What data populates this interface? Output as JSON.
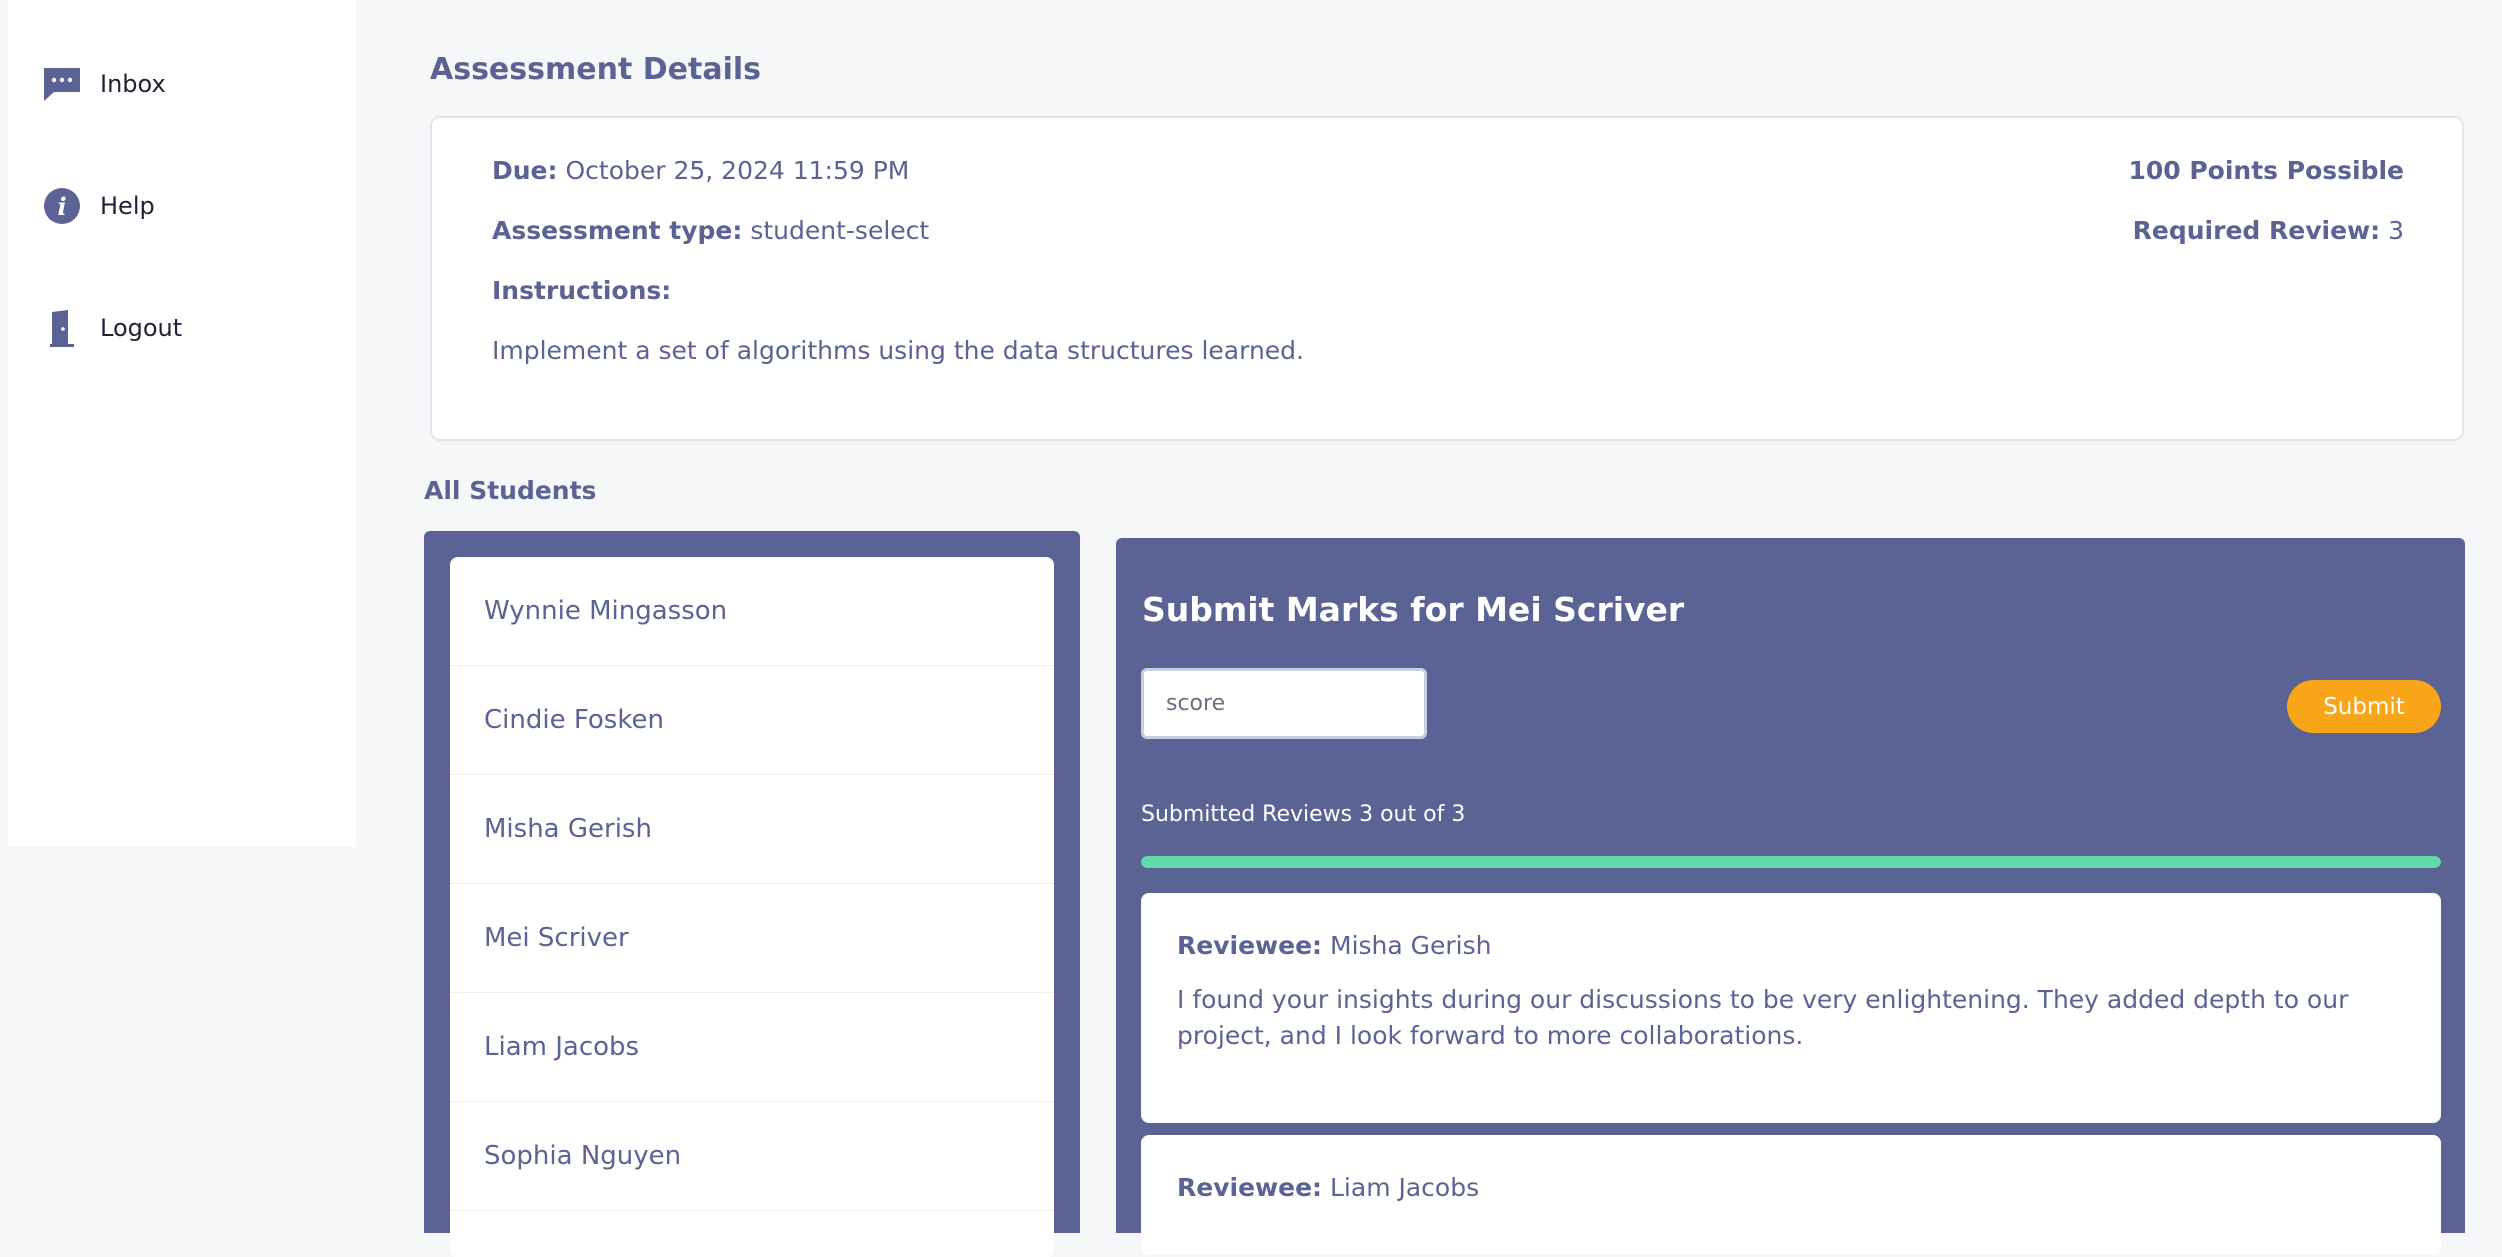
{
  "sidebar": {
    "items": [
      {
        "label": "Inbox",
        "icon": "chat-icon"
      },
      {
        "label": "Help",
        "icon": "info-icon"
      },
      {
        "label": "Logout",
        "icon": "door-icon"
      }
    ]
  },
  "page": {
    "title": "Assessment Details"
  },
  "details": {
    "due_label": "Due:",
    "due_value": "October 25, 2024 11:59 PM",
    "type_label": "Assessment type:",
    "type_value": "student-select",
    "instructions_label": "Instructions:",
    "instructions_text": "Implement a set of algorithms using the data structures learned.",
    "points": "100 Points Possible",
    "required_label": "Required Review:",
    "required_value": "3"
  },
  "students": {
    "label": "All Students",
    "items": [
      "Wynnie Mingasson",
      "Cindie Fosken",
      "Misha Gerish",
      "Mei Scriver",
      "Liam Jacobs",
      "Sophia Nguyen"
    ]
  },
  "marks": {
    "title": "Submit Marks for Mei Scriver",
    "score_placeholder": "score",
    "submit_label": "Submit",
    "progress_text": "Submitted Reviews 3 out of 3",
    "progress_fraction": 1.0,
    "reviews": [
      {
        "label": "Reviewee:",
        "name": "Misha Gerish",
        "comment": "I found your insights during our discussions to be very enlightening. They added depth to our project, and I look forward to more collaborations."
      },
      {
        "label": "Reviewee:",
        "name": "Liam Jacobs",
        "comment": ""
      }
    ]
  },
  "colors": {
    "panel": "#5a6394",
    "accent": "#f9a51a",
    "progress": "#63d8a8"
  }
}
